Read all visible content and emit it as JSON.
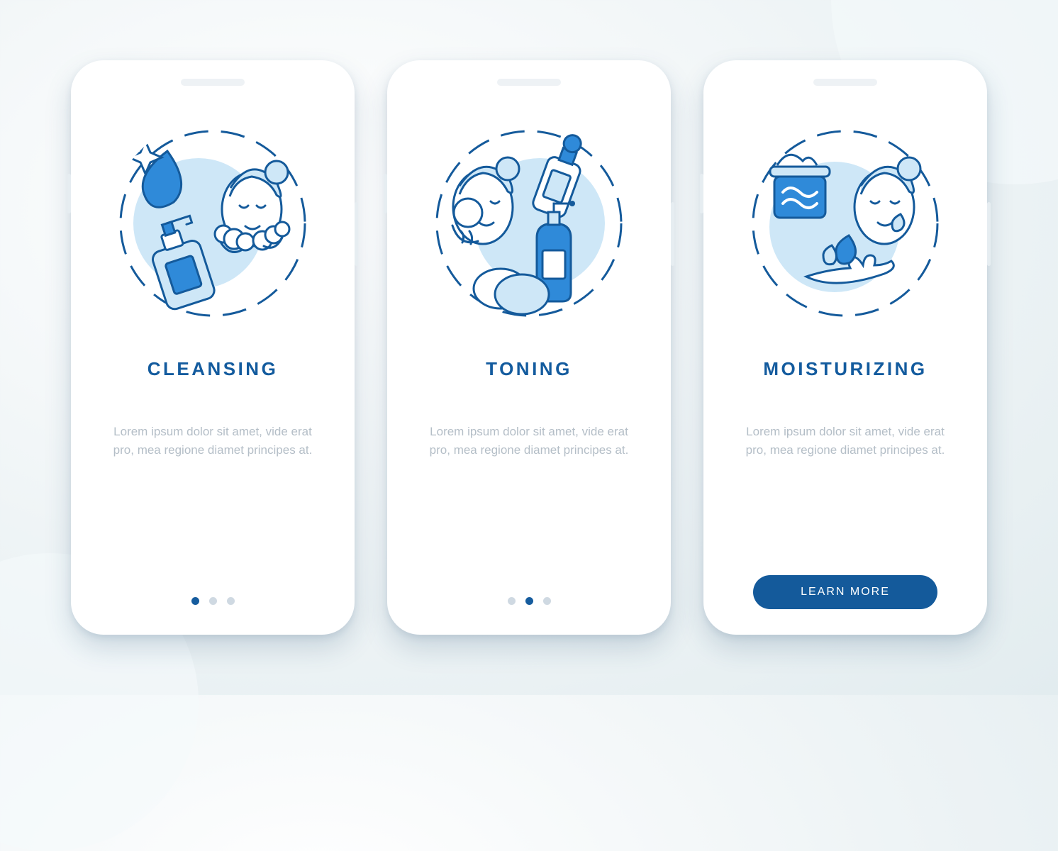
{
  "colors": {
    "primary": "#145a9b",
    "accent": "#2f8ad9",
    "light": "#cee7f7",
    "outline": "#145a9b",
    "muted_text": "#b4bec7"
  },
  "screens": [
    {
      "title": "CLEANSING",
      "description": "Lorem ipsum dolor sit amet, vide erat pro, mea regione diamet principes at.",
      "illustration": "cleansing-icon",
      "page_indicator": {
        "total": 3,
        "active_index": 0
      },
      "cta": null
    },
    {
      "title": "TONING",
      "description": "Lorem ipsum dolor sit amet, vide erat pro, mea regione diamet principes at.",
      "illustration": "toning-icon",
      "page_indicator": {
        "total": 3,
        "active_index": 1
      },
      "cta": null
    },
    {
      "title": "MOISTURIZING",
      "description": "Lorem ipsum dolor sit amet, vide erat pro, mea regione diamet principes at.",
      "illustration": "moisturizing-icon",
      "page_indicator": null,
      "cta": "LEARN MORE"
    }
  ]
}
